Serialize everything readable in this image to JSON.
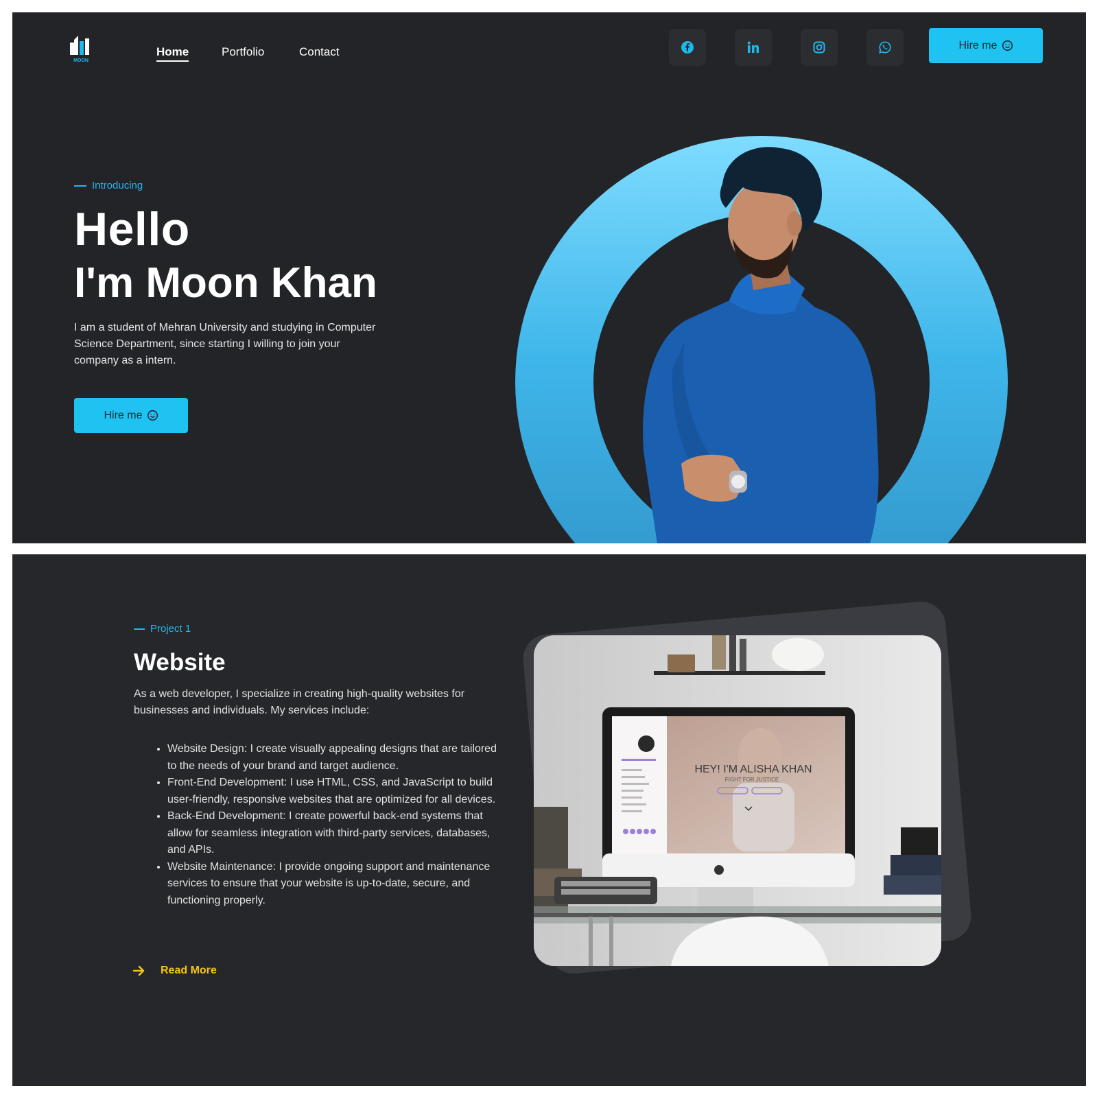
{
  "nav": {
    "logo_text": "MOON",
    "links": [
      "Home",
      "Portfolio",
      "Contact"
    ],
    "socials": [
      "facebook-icon",
      "linkedin-icon",
      "instagram-icon",
      "whatsapp-icon"
    ],
    "hire_label": "Hire me"
  },
  "hero": {
    "eyebrow": "Introducing",
    "line1": "Hello",
    "line2": "I'm Moon Khan",
    "description": "I am a student of Mehran University and studying in Computer Science Department, since starting I willing to join your company as a intern.",
    "hire_label": "Hire me"
  },
  "project": {
    "eyebrow": "Project 1",
    "title": "Website",
    "description": "As a web developer, I specialize in creating high-quality websites for businesses and individuals. My services include:",
    "services": [
      "Website Design: I create visually appealing designs that are tailored to the needs of your brand and target audience.",
      "Front-End Development: I use HTML, CSS, and JavaScript to build user-friendly, responsive websites that are optimized for all devices.",
      "Back-End Development: I create powerful back-end systems that allow for seamless integration with third-party services, databases, and APIs.",
      "Website Maintenance: I provide ongoing support and maintenance services to ensure that your website is up-to-date, secure, and functioning properly."
    ],
    "read_more": "Read More",
    "mockup": {
      "headline": "HEY! I'M ALISHA KHAN",
      "subline": "FIGHT FOR JUSTICE"
    }
  },
  "colors": {
    "accent": "#1fc3f2",
    "background": "#232428",
    "read_more": "#f5c518"
  }
}
